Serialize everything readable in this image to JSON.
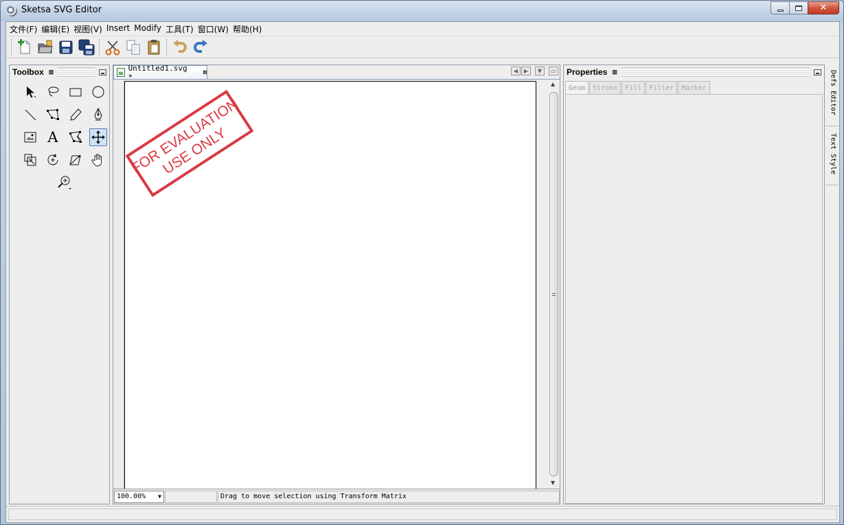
{
  "window": {
    "title": "Sketsa SVG Editor",
    "close_glyph": "✕"
  },
  "menu": [
    {
      "label": "文件(F)"
    },
    {
      "label": "编辑(E)"
    },
    {
      "label": "视图(V)"
    },
    {
      "label": "Insert"
    },
    {
      "label": "Modify"
    },
    {
      "label": "工具(T)"
    },
    {
      "label": "窗口(W)"
    },
    {
      "label": "帮助(H)"
    }
  ],
  "toolbar": {
    "icons": [
      "new-document-icon",
      "open-folder-icon",
      "save-icon",
      "save-all-icon",
      "cut-icon",
      "copy-icon",
      "paste-icon",
      "undo-icon",
      "redo-icon"
    ]
  },
  "toolbox": {
    "title": "Toolbox",
    "close_glyph": "⊠",
    "tools": [
      "select-tool",
      "lasso-tool",
      "rectangle-tool",
      "ellipse-tool",
      "line-tool",
      "polygon-tool",
      "pencil-tool",
      "pen-tool",
      "image-tool",
      "text-tool",
      "node-edit-tool",
      "transform-matrix-tool",
      "scale-tool",
      "rotate-tool",
      "skew-tool",
      "pan-tool",
      "zoom-tool"
    ],
    "active_tool": "transform-matrix-tool",
    "text_tool_glyph": "A"
  },
  "document": {
    "tab_label": "Untitled1.svg *",
    "close_glyph": "⊠",
    "watermark_line1": "FOR EVALUATION",
    "watermark_line2": "USE ONLY",
    "watermark_color": "#d93a43",
    "zoom": "100.00%",
    "status_message": "Drag to move selection using Transform Matrix",
    "nav_prev": "◀",
    "nav_next": "▶",
    "nav_menu": "▼",
    "nav_restore": "▭",
    "scroll_up": "▲",
    "scroll_down": "▼",
    "zoom_arrow": "▼"
  },
  "properties": {
    "title": "Properties",
    "close_glyph": "⊠",
    "tabs": [
      "Geom",
      "Stroke",
      "Fill",
      "Filter",
      "Marker"
    ],
    "active_tab": "Geom"
  },
  "side_tabs": [
    "Defs Editor",
    "Text Style"
  ]
}
